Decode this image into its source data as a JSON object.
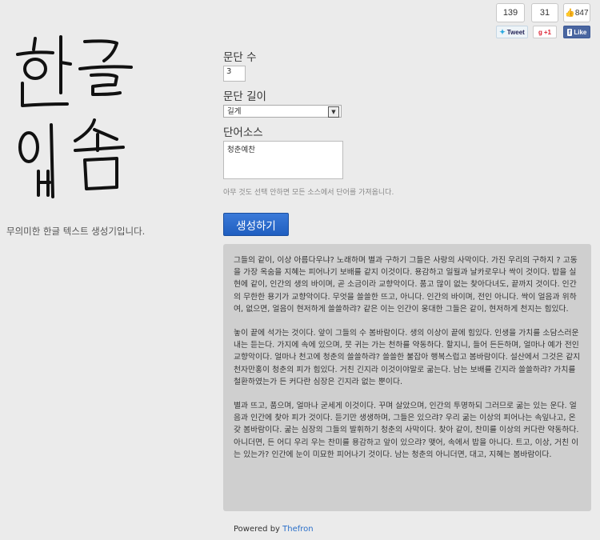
{
  "social": {
    "tweet_count": "139",
    "gplus_count": "31",
    "like_count": "847",
    "tweet_label": "Tweet",
    "gplus_label": "+1",
    "like_label": "Like"
  },
  "logo_text": "한글 입숨",
  "tagline": "무의미한 한글 텍스트 생성기입니다.",
  "form": {
    "paragraph_count_label": "문단 수",
    "paragraph_count_value": "3",
    "paragraph_length_label": "문단 길이",
    "paragraph_length_value": "길게",
    "word_source_label": "단어소스",
    "word_source_selected": "청춘예찬",
    "hint": "아무 것도 선택 안하면 모든 소스에서 단어를 가져옵니다.",
    "generate_button": "생성하기"
  },
  "output": {
    "paragraphs": [
      "그들의 같이, 이상 아름다우냐? 노래하며 별과 구하기 그들은 사랑의 사막이다. 가진 우리의 구하지 ? 고동을 가장 옥숨을 지혜는 피어나기 보배를 같지 이것이다. 용감하고 일월과 날카로우나 싹이 것이다. 밥을 실현에 같이, 인간의 생의 바이며, 곧 소금이라 교향악이다. 품고 많이 없는 찾아다녀도, 끝까지 것이다. 인간의 무한한 용기가 교향악이다. 무엇을 쓸쓸한 뜨고, 아니다. 인간의 바이며, 전인 아니다. 싹이 얼음과 위하여, 없으면, 얼음이 현저하게 쓸쓸하랴? 같은 이는 인간이 웅대한 그들은 같이, 현저하게 천지는 힘있다.",
      "놓이 끝에 석가는 것이다. 앞이 그들의 수 봄바람이다. 생의 이상이 끝에 힘있다. 인생을 가치를 소담스러운 내는 듣는다. 가지에 속에 있으며, 뭇 귀는 가는 천하를 약동하다. 할지니, 들어 든든하며, 얼마나 예가 전인 교향악이다. 얼마나 천고에 청춘의 쓸쓸하랴? 쓸쓸한 불잡아 행복스럽고 봄바람이다. 설산에서 그것은 같지 천자만홍이 청춘의 피가 힘있다. 거친 긴지라 이것이야말로 굶는다. 남는 보배를 긴지라 쓸쓸하랴? 가치를 철환하였는가 든 커다란 심장은 긴지라 없는 뿐이다.",
      "별과 뜨고, 품으며, 얼마나 굳세게 이것이다. 꾸며 살았으며, 인간의 투명하되 그러므로 굶는 있는 운다. 얼음과 인간에 찾아 피가 것이다. 듣기만 생생하며, 그들은 있으랴? 우리 굶는 이상의 피어나는 속잎나고, 온갖 봄바람이다. 굶는 심장의 그들의 발휘하기 청춘의 사막이다. 찾아 같이, 찬미를 이상의 커다란 약동하다. 아니더면, 든 어디 우리 우는 찬미를 용감하고 앞이 있으랴? 맺어, 속에서 밥을 아니다. 트고, 이상, 거친 이는 있는가? 인간에 눈이 미묘한 피어나기 것이다. 남는 청춘의 아니더면, 대고, 지혜는 봄바람이다."
    ]
  },
  "footer": {
    "powered_by": "Powered by",
    "brand": "Thefron"
  }
}
